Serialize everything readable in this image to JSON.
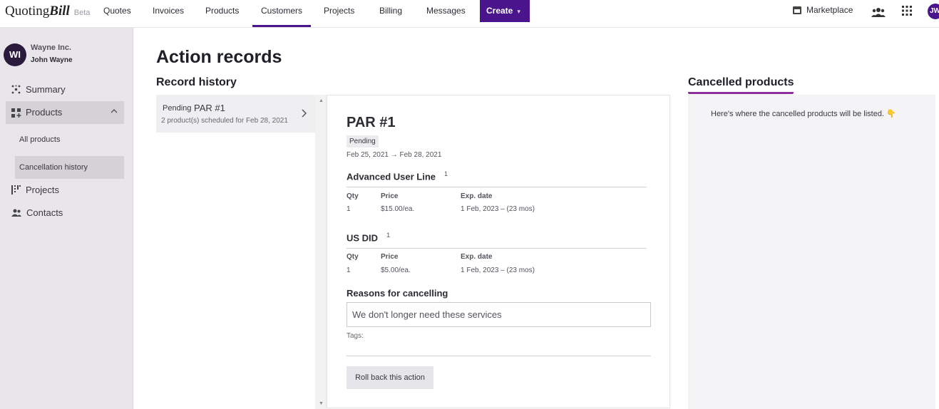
{
  "brand": {
    "name_plain": "Quoting",
    "name_bold": "Bill",
    "badge": "Beta"
  },
  "nav": {
    "items": [
      "Quotes",
      "Invoices",
      "Products",
      "Customers",
      "Projects",
      "Billing",
      "Messages"
    ],
    "active": "Customers",
    "create_label": "Create",
    "marketplace_label": "Marketplace",
    "user_initials": "JW"
  },
  "sidebar": {
    "org_initials": "WI",
    "org_name": "Wayne Inc.",
    "user_name": "John Wayne",
    "items": {
      "summary": "Summary",
      "products": "Products",
      "all_products": "All products",
      "cancellation_history": "Cancellation history",
      "projects": "Projects",
      "contacts": "Contacts"
    }
  },
  "main": {
    "title": "Action records",
    "record_history_heading": "Record history",
    "cancelled_heading": "Cancelled products",
    "records": [
      {
        "status": "Pending",
        "name": "PAR #1",
        "subtitle": "2 product(s) scheduled for Feb 28, 2021"
      }
    ],
    "detail": {
      "title": "PAR #1",
      "status": "Pending",
      "dates": "Feb 25, 2021 → Feb 28, 2021",
      "columns": {
        "qty": "Qty",
        "price": "Price",
        "exp": "Exp. date"
      },
      "products": [
        {
          "name": "Advanced User Line",
          "sup": "1",
          "qty": "1",
          "price": "$15.00/ea.",
          "exp": "1 Feb, 2023 – (23 mos)"
        },
        {
          "name": "US DID",
          "sup": "1",
          "qty": "1",
          "price": "$5.00/ea.",
          "exp": "1 Feb, 2023 – (23 mos)"
        }
      ],
      "reasons_heading": "Reasons for cancelling",
      "reason_text": "We don't longer need these services",
      "tags_label": "Tags:",
      "rollback_label": "Roll back this action"
    },
    "cancelled_message": "Here's where the cancelled products will be listed. 👇"
  },
  "colors": {
    "accent": "#4a148c",
    "underline": "#8b2f9c",
    "sidebar_bg": "#e8e6ea"
  }
}
